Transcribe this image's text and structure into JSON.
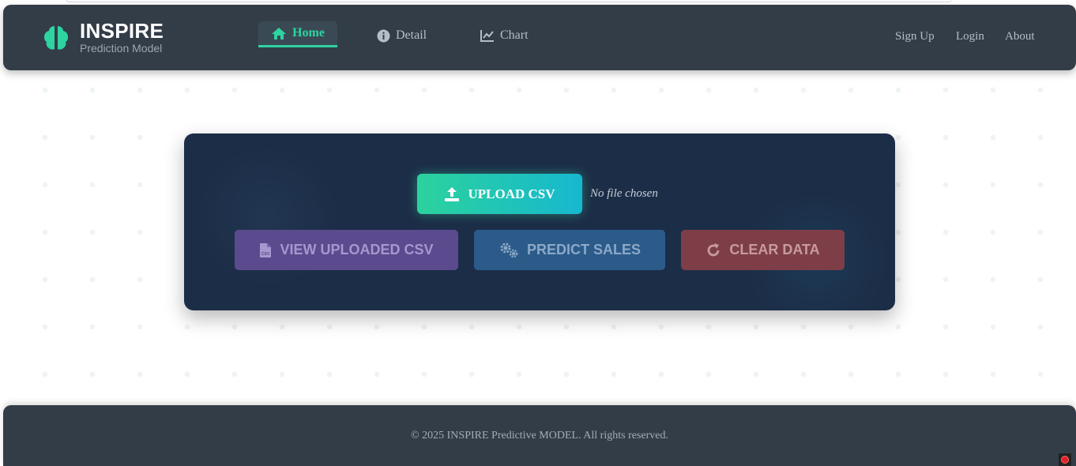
{
  "brand": {
    "title": "INSPIRE",
    "subtitle": "Prediction Model",
    "icon": "brain-icon"
  },
  "nav": {
    "items": [
      {
        "label": "Home",
        "icon": "home-icon",
        "active": true
      },
      {
        "label": "Detail",
        "icon": "info-icon",
        "active": false
      },
      {
        "label": "Chart",
        "icon": "line-chart-icon",
        "active": false
      }
    ],
    "right": [
      {
        "label": "Sign Up"
      },
      {
        "label": "Login"
      },
      {
        "label": "About"
      }
    ]
  },
  "upload": {
    "button_label": "UPLOAD CSV",
    "file_status": "No file chosen"
  },
  "actions": [
    {
      "label": "VIEW UPLOADED CSV",
      "icon": "csv-file-icon",
      "color": "#5b4b8e"
    },
    {
      "label": "PREDICT SALES",
      "icon": "cogs-icon",
      "color": "#2c5b8a"
    },
    {
      "label": "CLEAR DATA",
      "icon": "redo-icon",
      "color": "#7e3e48"
    }
  ],
  "footer": {
    "text": "© 2025 INSPIRE Predictive MODEL. All rights reserved."
  },
  "colors": {
    "accent": "#2ed3a1",
    "navbar": "#333d48",
    "card": "#1c2d47"
  }
}
